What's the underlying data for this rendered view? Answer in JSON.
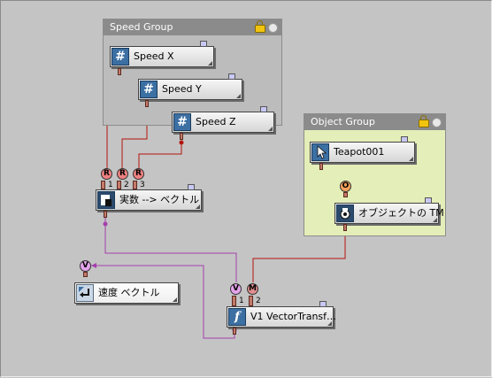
{
  "groups": {
    "speed": {
      "title": "Speed Group"
    },
    "object": {
      "title": "Object Group"
    }
  },
  "nodes": {
    "speed_x": {
      "label": "Speed X",
      "icon": "#"
    },
    "speed_y": {
      "label": "Speed Y",
      "icon": "#"
    },
    "speed_z": {
      "label": "Speed Z",
      "icon": "#"
    },
    "teapot": {
      "label": "Teapot001"
    },
    "object_tm": {
      "label": "オブジェクトの TM"
    },
    "real_to_vector": {
      "label": "実数 --> ベクトル"
    },
    "speed_vector": {
      "label": "速度 ベクトル"
    },
    "vector_transform": {
      "label": "V1 VectorTransf…",
      "icon": "f"
    }
  },
  "sockets": {
    "r": "R",
    "o": "O",
    "v": "V",
    "m": "M"
  },
  "pins": {
    "n1": "1",
    "n2": "2",
    "n3": "3"
  },
  "colors": {
    "canvas": "#c4c4c4",
    "speed_group": "#bcbcbc",
    "object_group": "#e4eeb8",
    "wire_red": "#b3140e",
    "wire_orange": "#f39c12",
    "wire_purple": "#a43fad"
  },
  "icons": {
    "speed_group": [
      "lock-icon",
      "dot-icon"
    ],
    "object_group": [
      "lock-icon",
      "dot-icon"
    ]
  }
}
